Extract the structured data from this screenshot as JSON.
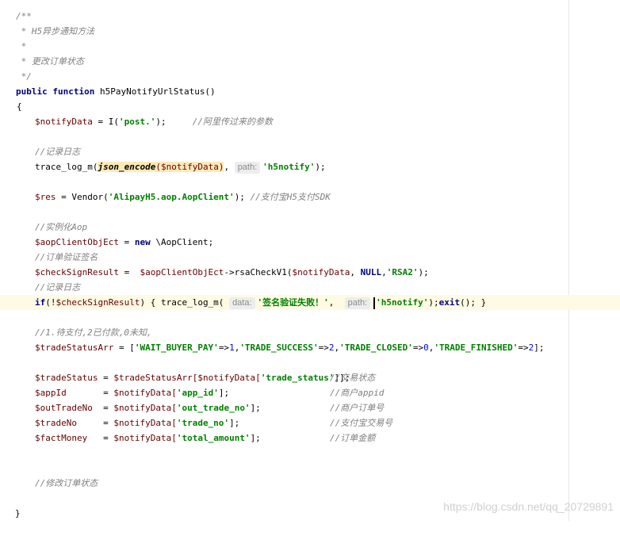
{
  "editor": {
    "doc": {
      "open": "/**",
      "line1": " * H5异步通知方法",
      "line2": " *",
      "line3": " * 更改订单状态",
      "close": " */"
    },
    "signature": {
      "kw1": "public",
      "kw2": "function",
      "name": "h5PayNotifyUrlStatus()"
    },
    "brace_open": "{",
    "brace_close": "}",
    "notify": {
      "var": "$notifyData",
      "eq": " = I(",
      "str": "'post.'",
      "end": ");",
      "comment": "//阿里传过来的参数"
    },
    "log_comment1": "//记录日志",
    "trace1": {
      "fn": "trace_log_m(",
      "inner_fn": "json_encode",
      "inner_args": "($notifyData)",
      "comma": ",",
      "hint": "path:",
      "str": "'h5notify'",
      "end": ");"
    },
    "vendor": {
      "var": "$res",
      "eq": " = Vendor(",
      "str": "'AlipayH5.aop.AopClient'",
      "end": ");",
      "comment": "//支付宝H5支付SDK"
    },
    "inst_comment": "//实例化Aop",
    "aop": {
      "var": "$aopClientObjEct",
      "eq": " = ",
      "kw": "new",
      "rest": " \\AopClient;"
    },
    "sign_comment": "//订单验证签名",
    "check": {
      "var": "$checkSignResult",
      "eq": " =  ",
      "obj": "$aopClientObjEct",
      "call": "->rsaCheckV1(",
      "arg": "$notifyData",
      "comma": ", ",
      "null": "NULL",
      "comma2": ",",
      "str": "'RSA2'",
      "end": ");"
    },
    "log_comment2": "//记录日志",
    "iflog": {
      "kw_if": "if",
      "cond_open": "(!",
      "cond_var": "$checkSignResult",
      "cond_close": ") { trace_log_m(",
      "hint1": "data:",
      "str1": "'签名验证失败！'",
      "comma": ", ",
      "hint2": "path:",
      "str2": "'h5notify'",
      "mid": ");",
      "kw_exit": "exit",
      "end": "(); }"
    },
    "status_comment": "//1.待支付,2已付款,0未知,",
    "arr": {
      "var": "$tradeStatusArr",
      "eq": " = [",
      "s1": "'WAIT_BUYER_PAY'",
      "a1": "=>",
      "n1": "1",
      "c1": ",",
      "s2": "'TRADE_SUCCESS'",
      "a2": "=>",
      "n2": "2",
      "c2": ",",
      "s3": "'TRADE_CLOSED'",
      "a3": "=>",
      "n3": "0",
      "c3": ",",
      "s4": "'TRADE_FINISHED'",
      "a4": "=>",
      "n4": "2",
      "end": "];"
    },
    "assign": [
      {
        "var": "$tradeStatus",
        "pad": " = ",
        "src": "$tradeStatusArr[",
        "src2": "$notifyData[",
        "key": "'trade_status'",
        "close": "]];",
        "comment": "//交易状态"
      },
      {
        "var": "$appId",
        "pad": "       = ",
        "src": "",
        "src2": "$notifyData[",
        "key": "'app_id'",
        "close": "];",
        "comment": "//商户appid"
      },
      {
        "var": "$outTradeNo",
        "pad": "  = ",
        "src": "",
        "src2": "$notifyData[",
        "key": "'out_trade_no'",
        "close": "];",
        "comment": "//商户订单号"
      },
      {
        "var": "$tradeNo",
        "pad": "     = ",
        "src": "",
        "src2": "$notifyData[",
        "key": "'trade_no'",
        "close": "];",
        "comment": "//支付宝交易号"
      },
      {
        "var": "$factMoney",
        "pad": "   = ",
        "src": "",
        "src2": "$notifyData[",
        "key": "'total_amount'",
        "close": "];",
        "comment": "//订单金额"
      }
    ],
    "modify_comment": "//修改订单状态"
  },
  "watermark": "https://blog.csdn.net/qq_20729891",
  "colors": {
    "keyword": "#000080",
    "string": "#008000",
    "comment": "#808080",
    "variable": "#660000",
    "number": "#0000ff",
    "current_line": "#fffae3",
    "highlight": "#fce9b8"
  }
}
